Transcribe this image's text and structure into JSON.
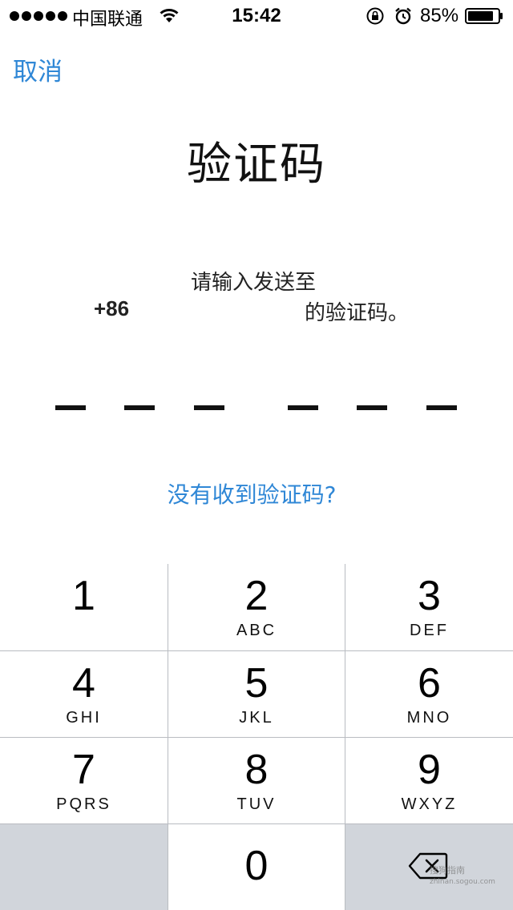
{
  "status_bar": {
    "carrier": "中国联通",
    "time": "15:42",
    "battery_percent": "85%",
    "icons": [
      "signal-dots-icon",
      "wifi-icon",
      "orientation-lock-icon",
      "alarm-icon",
      "battery-icon"
    ]
  },
  "nav": {
    "cancel_label": "取消"
  },
  "screen": {
    "title": "验证码",
    "instruction_line1": "请输入发送至",
    "phone_prefix": "+86",
    "instruction_line2": "的验证码。",
    "code_slots": 6,
    "resend_label": "没有收到验证码?"
  },
  "keypad": {
    "keys": [
      {
        "num": "1",
        "letters": ""
      },
      {
        "num": "2",
        "letters": "ABC"
      },
      {
        "num": "3",
        "letters": "DEF"
      },
      {
        "num": "4",
        "letters": "GHI"
      },
      {
        "num": "5",
        "letters": "JKL"
      },
      {
        "num": "6",
        "letters": "MNO"
      },
      {
        "num": "7",
        "letters": "PQRS"
      },
      {
        "num": "8",
        "letters": "TUV"
      },
      {
        "num": "9",
        "letters": "WXYZ"
      },
      {
        "num": "0",
        "letters": ""
      }
    ],
    "delete_icon": "backspace-icon"
  },
  "watermark": {
    "line1": "搜狗指南",
    "line2": "zhinan.sogou.com"
  },
  "colors": {
    "accent": "#2f87d6",
    "keypad_gray": "#d1d5db",
    "divider": "#b9bcc1"
  }
}
